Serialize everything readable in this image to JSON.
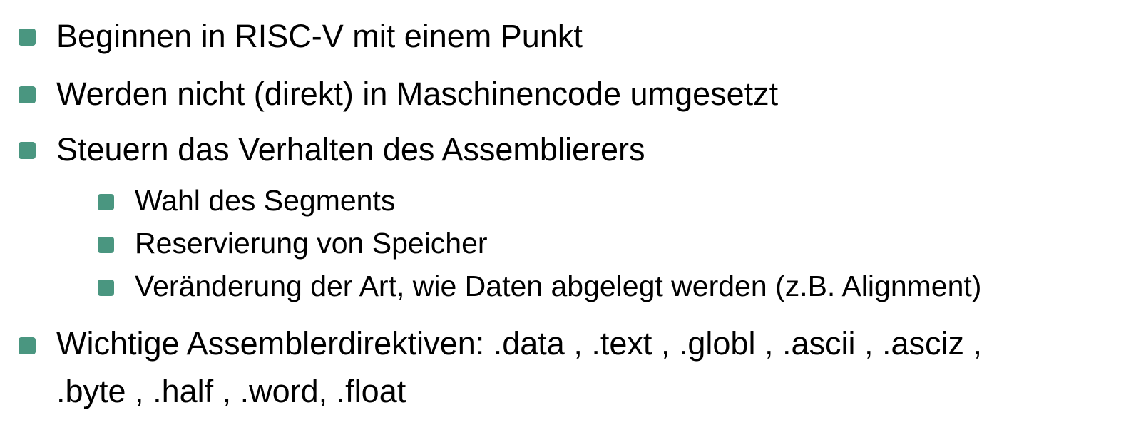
{
  "accent_color": "#4a9680",
  "bullet_icon": "rounded-square-bullet",
  "items": [
    {
      "text": "Beginnen in RISC-V mit einem Punkt"
    },
    {
      "text": "Werden nicht (direkt) in Maschinencode umgesetzt"
    },
    {
      "text": "Steuern das Verhalten des Assemblierers"
    },
    {
      "text": "Wahl des Segments"
    },
    {
      "text": "Reservierung von Speicher"
    },
    {
      "text": "Veränderung der Art, wie Daten abgelegt werden (z.B. Alignment)"
    },
    {
      "text": "Wichtige Assemblerdirektiven: .data , .text , .globl , .ascii , .asciz ,",
      "continuation": ".byte , .half , .word, .float"
    }
  ]
}
